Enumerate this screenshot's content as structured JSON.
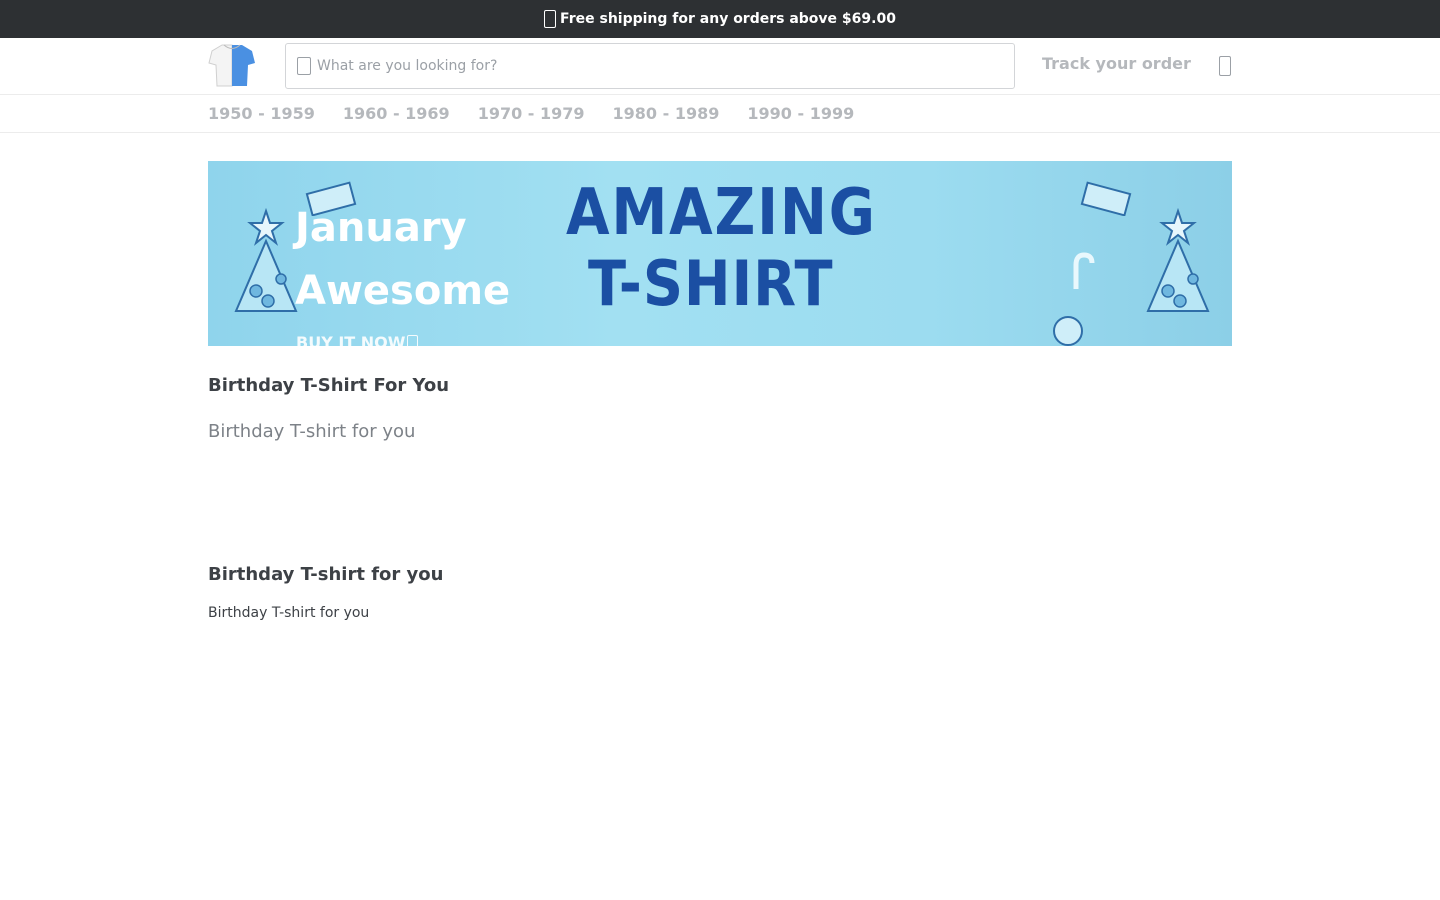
{
  "announcement": {
    "text": "Free shipping for any orders above $69.00",
    "icon": "truck-icon"
  },
  "header": {
    "search_placeholder": "What are you looking for?",
    "track_label": "Track your order",
    "cart_icon": "cart-icon"
  },
  "nav": {
    "items": [
      {
        "label": "1950 - 1959"
      },
      {
        "label": "1960 - 1969"
      },
      {
        "label": "1970 - 1979"
      },
      {
        "label": "1980 - 1989"
      },
      {
        "label": "1990 - 1999"
      }
    ]
  },
  "banner": {
    "line1": "January",
    "line2": "Awesome",
    "cta": "BUY IT NOW",
    "image_text_1": "AMAZING",
    "image_text_2": "T-SHIRT"
  },
  "section": {
    "title": "Birthday T-Shirt For You",
    "subtitle": "Birthday T-shirt for you"
  },
  "content": {
    "heading": "Birthday T-shirt for you",
    "paragraph": "Birthday T-shirt for you"
  },
  "colors": {
    "topbar_bg": "#2d3033",
    "banner_bg": "#9cdcf0",
    "banner_text": "#1b4fa3",
    "muted_nav": "#b5b8bc"
  }
}
